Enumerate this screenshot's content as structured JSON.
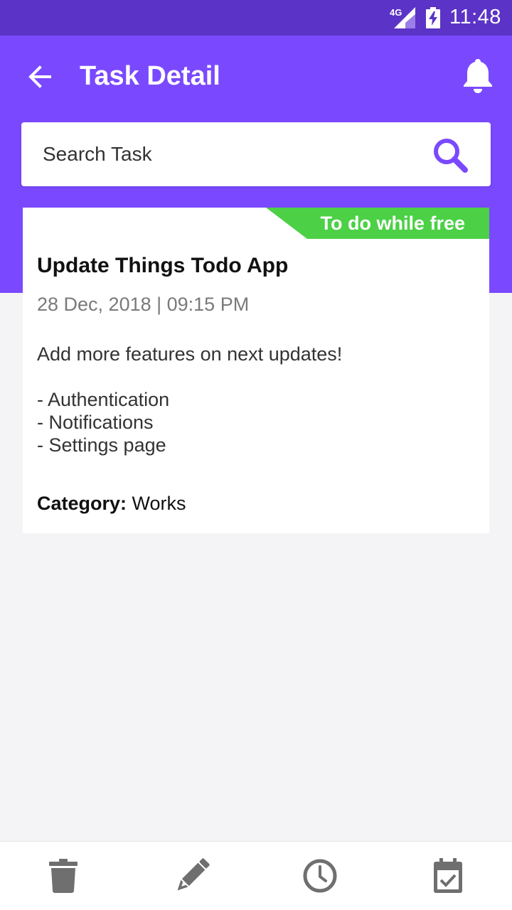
{
  "status_bar": {
    "network": "4G",
    "time": "11:48",
    "icons": [
      "signal-icon",
      "battery-charging-icon"
    ]
  },
  "header": {
    "title": "Task Detail",
    "back_icon": "arrow-back-icon",
    "bell_icon": "bell-icon"
  },
  "search": {
    "placeholder": "Search Task",
    "icon": "search-icon"
  },
  "task": {
    "tag": "To do while free",
    "title": "Update Things Todo App",
    "datetime": "28 Dec, 2018 | 09:15 PM",
    "description": "Add more features on next updates!",
    "items": [
      "- Authentication",
      "- Notifications",
      "- Settings page"
    ],
    "category_label": "Category:",
    "category_value": "Works"
  },
  "bottom_actions": [
    "trash-icon",
    "pencil-icon",
    "clock-icon",
    "calendar-check-icon"
  ],
  "colors": {
    "status_bar": "#5b33c6",
    "header": "#7a49ff",
    "accent": "#7a49ff",
    "tag": "#4cd046",
    "icon_gray": "#6f6f6f",
    "background": "#f4f4f6"
  }
}
